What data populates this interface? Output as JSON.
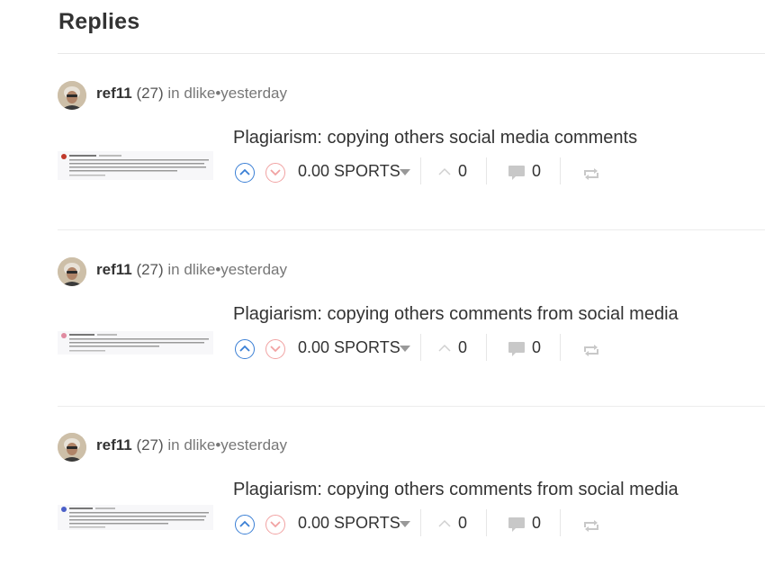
{
  "page": {
    "heading": "Replies"
  },
  "replies": [
    {
      "author": "ref11",
      "reputation": "(27)",
      "in_label": "in",
      "community": "dlike",
      "separator": "•",
      "time": "yesterday",
      "title": "Plagiarism: copying others social media comments",
      "payout": "0.00 SPORTS",
      "likes": "0",
      "comments": "0",
      "thumb_accent": "#c0392b"
    },
    {
      "author": "ref11",
      "reputation": "(27)",
      "in_label": "in",
      "community": "dlike",
      "separator": "•",
      "time": "yesterday",
      "title": "Plagiarism: copying others comments from social media",
      "payout": "0.00 SPORTS",
      "likes": "0",
      "comments": "0",
      "thumb_accent": "#e08aa0"
    },
    {
      "author": "ref11",
      "reputation": "(27)",
      "in_label": "in",
      "community": "dlike",
      "separator": "•",
      "time": "yesterday",
      "title": "Plagiarism: copying others comments from social media",
      "payout": "0.00 SPORTS",
      "likes": "0",
      "comments": "0",
      "thumb_accent": "#4a5fc8"
    }
  ],
  "colors": {
    "upvote": "#3a7fd5",
    "downvote": "#f1a2a2",
    "icon_gray": "#c8c8c8"
  },
  "icons": {
    "upvote": "chevron-up-icon",
    "downvote": "chevron-down-icon",
    "likes": "caret-up-icon",
    "comments": "comment-bubble-icon",
    "reblog": "reblog-icon"
  }
}
